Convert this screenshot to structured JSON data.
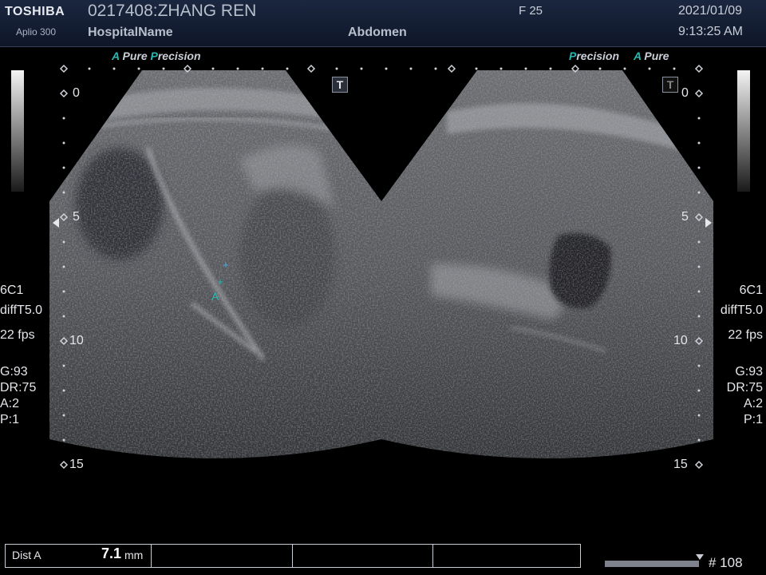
{
  "header": {
    "brand": "TOSHIBA",
    "model": "Aplio 300",
    "patient": "0217408:ZHANG REN",
    "hospital": "HospitalName",
    "frame": "F  25",
    "exam": "Abdomen",
    "date": "2021/01/09",
    "time": "9:13:25 AM"
  },
  "left_pane": {
    "logo_a": "A",
    "logo_pure": "Pure",
    "logo_p": "P",
    "logo_recision": "recision",
    "depth_labels": [
      "0",
      "5",
      "10",
      "15"
    ],
    "probe": "6C1",
    "mode": "diffT5.0",
    "fps": "22 fps",
    "gain": "G:93",
    "dr": "DR:75",
    "a": "A:2",
    "p": "P:1",
    "t_icon": "T",
    "caliper_label": "A"
  },
  "right_pane": {
    "logo_p": "P",
    "logo_recision": "recision",
    "logo_a": "A",
    "logo_pure": "Pure",
    "depth_labels": [
      "0",
      "5",
      "10",
      "15"
    ],
    "probe": "6C1",
    "mode": "diffT5.0",
    "fps": "22 fps",
    "gain": "G:93",
    "dr": "DR:75",
    "a": "A:2",
    "p": "P:1",
    "t_icon": "T"
  },
  "measurement": {
    "label": "Dist A",
    "value": "7.1",
    "unit": "mm"
  },
  "cine": {
    "frame_count": "# 108",
    "position_fraction": 0.97
  },
  "colors": {
    "accent": "#2bb7b1",
    "header_bg": "#15203a",
    "text": "#d8dce6"
  }
}
